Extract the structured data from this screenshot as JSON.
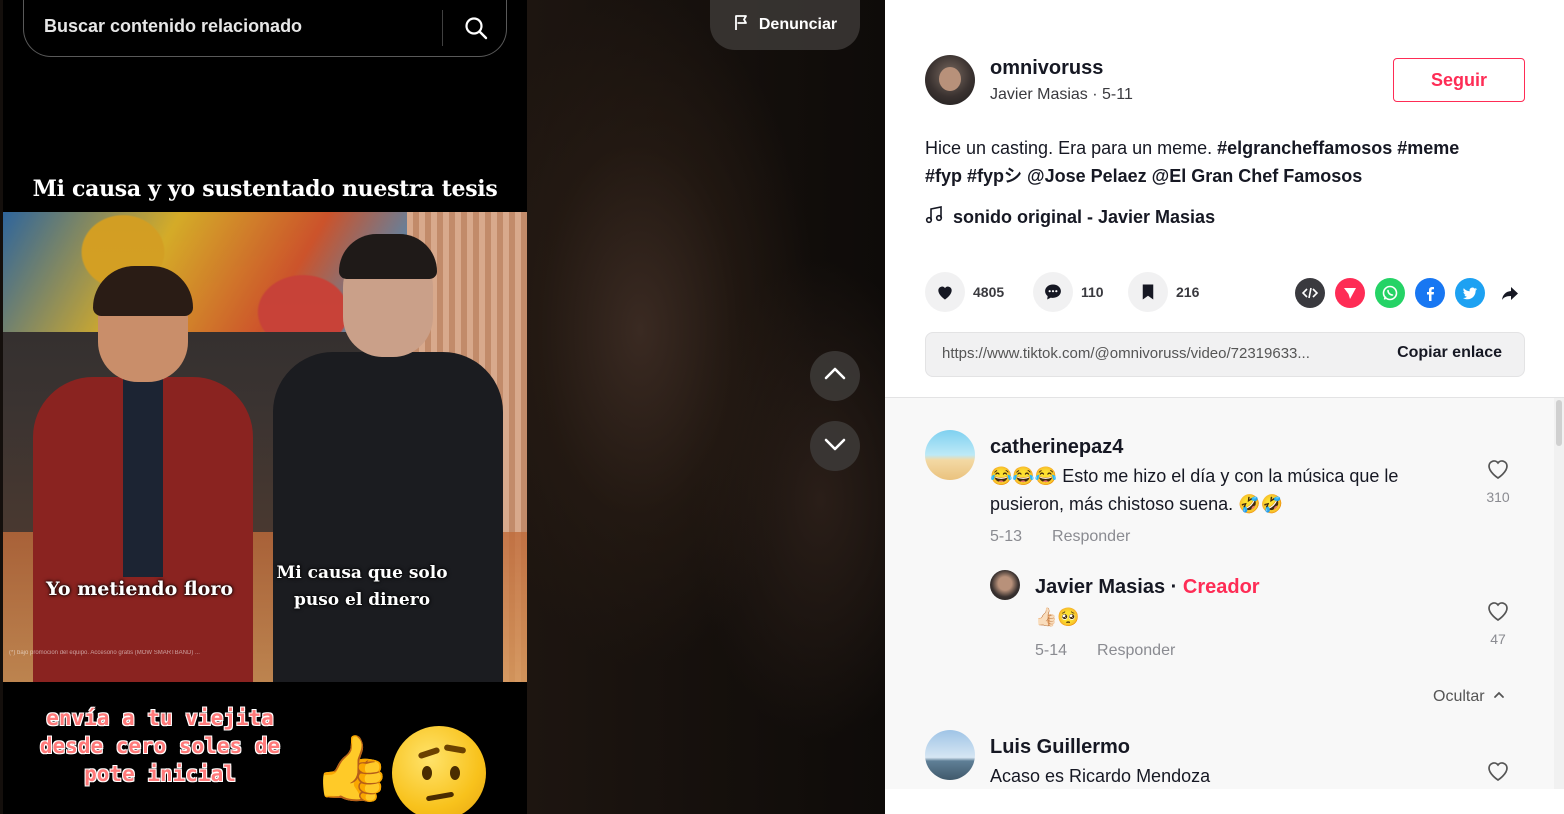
{
  "search": {
    "placeholder": "Buscar contenido relacionado"
  },
  "report": {
    "label": "Denunciar"
  },
  "video": {
    "caption_top": "Mi causa y yo sustentado nuestra tesis",
    "caption_left": "Yo metiendo floro",
    "caption_right": "Mi causa que solo puso el dinero",
    "promo_text": "envía a tu viejita desde cero soles de pote inicial",
    "fineprint": "(*) bajo promocion del equipo. Accesorio gratis (MOW SMARTBAND) ...",
    "emoji_thumb": "👍",
    "emoji_face": "face-with-raised-eyebrow"
  },
  "author": {
    "username": "omnivoruss",
    "meta": "Javier Masias · 5-11",
    "follow_label": "Seguir"
  },
  "description": {
    "text": "Hice un casting. Era para un meme.",
    "tags_line1": "#elgrancheffamosos #meme",
    "tags_line2": "#fyp #fypシ @Jose Pelaez @El Gran Chef Famosos"
  },
  "music": {
    "label": "sonido original - Javier Masias"
  },
  "stats": {
    "likes": "4805",
    "comments": "110",
    "saves": "216"
  },
  "link": {
    "url": "https://www.tiktok.com/@omnivoruss/video/72319633...",
    "copy_label": "Copiar enlace"
  },
  "comments": [
    {
      "user": "catherinepaz4",
      "text_line1": "😂😂😂 Esto me hizo el día y con la música que le",
      "text_line2": "pusieron, más chistoso suena. 🤣🤣",
      "date": "5-13",
      "reply_label": "Responder",
      "likes": "310"
    },
    {
      "user": "Javier Masias",
      "badge": "Creador",
      "text": "👍🏻🥺",
      "date": "5-14",
      "reply_label": "Responder",
      "likes": "47"
    },
    {
      "user": "Luis Guillermo",
      "text": "Acaso es Ricardo Mendoza"
    }
  ],
  "hide_label": "Ocultar",
  "colors": {
    "accent": "#fe2c55",
    "text": "#161823",
    "muted": "#8a8b91"
  }
}
